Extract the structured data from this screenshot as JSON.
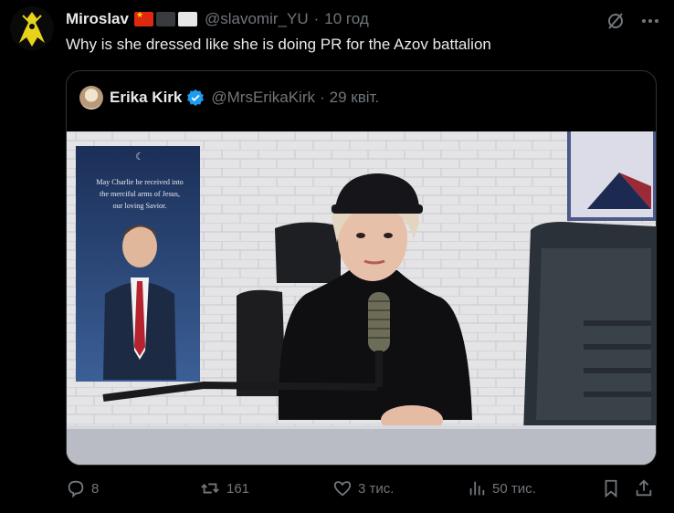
{
  "post": {
    "author_name": "Miroslav",
    "handle": "@slavomir_YU",
    "separator": "·",
    "time": "10 год",
    "text": "Why is she dressed like she is doing PR for the Azov battalion"
  },
  "quote": {
    "author_name": "Erika Kirk",
    "handle": "@MrsErikaKirk",
    "separator": "·",
    "time": "29 квіт.",
    "poster_text": [
      "May Charlie be received into",
      "the merciful arms of Jesus,",
      "our loving Savior."
    ]
  },
  "actions": {
    "replies": "8",
    "reposts": "161",
    "likes": "3 тис.",
    "views": "50 тис."
  },
  "colors": {
    "text_primary": "#e7e9ea",
    "text_secondary": "#71767b",
    "border": "#2f3336",
    "verified": "#1d9bf0"
  }
}
